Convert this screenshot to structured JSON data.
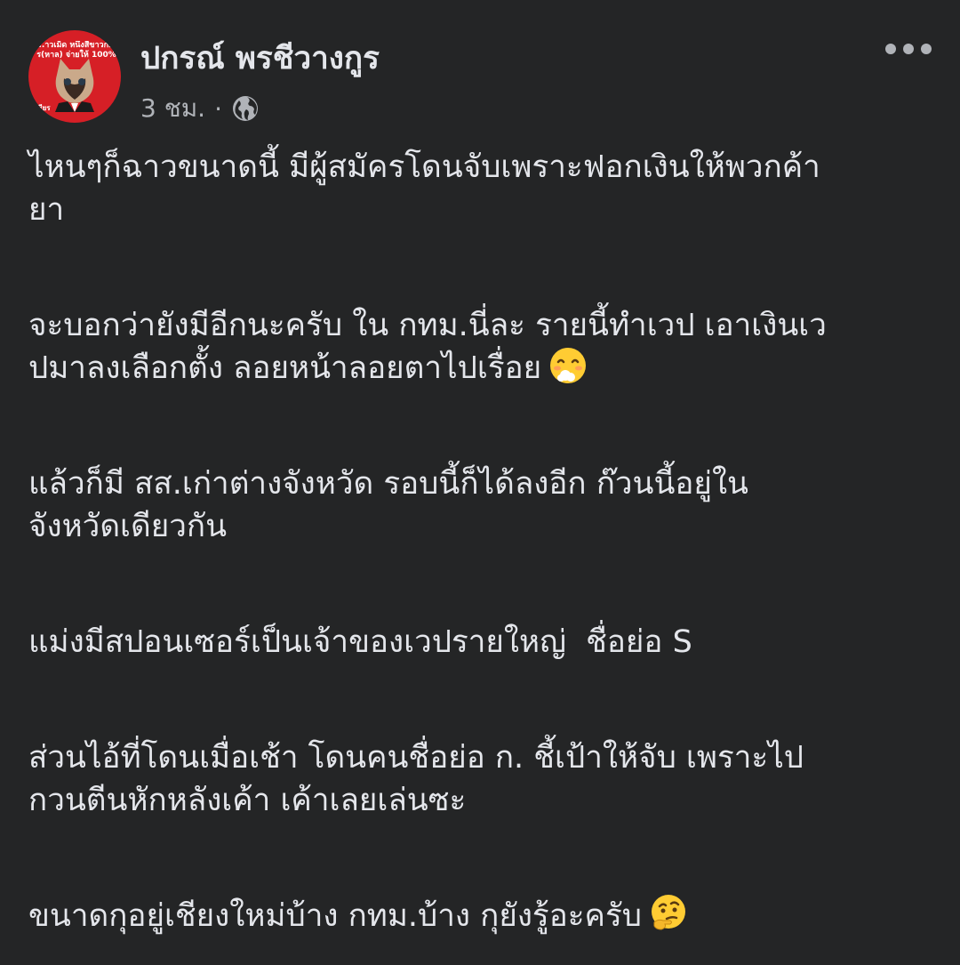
{
  "post": {
    "author": "ปกรณ์ พรชีวางกูร",
    "time": "3 ชม.",
    "separator": "·",
    "privacy_icon": "globe-icon",
    "more_icon": "more-horizontal-icon",
    "avatar": {
      "text_line1": "...าวเม็ด หนึ่งสีขาวกมะ",
      "text_line2": "ร(หาล) จ่ายให้ 100%",
      "text_line3": "ชเชียร",
      "background": "#d61f26"
    },
    "paragraphs": [
      {
        "lines": [
          "ไหนๆก็ฉาวขนาดนี้ มีผู้สมัครโดนจับเพราะฟอกเงินให้พวกค้า",
          "ยา"
        ]
      },
      {
        "lines": [
          "จะบอกว่ายังมีอีกนะครับ ใน กทม.นี่ละ รายนี้ทำเวป เอาเงินเว",
          "ปมาลงเลือกตั้ง ลอยหน้าลอยตาไปเรื่อย"
        ],
        "emoji": "face-exhaling-emoji"
      },
      {
        "lines": [
          "แล้วก็มี สส.เก่าต่างจังหวัด รอบนี้ก็ได้ลงอีก ก๊วนนี้อยู่ใน",
          "จังหวัดเดียวกัน"
        ]
      },
      {
        "lines": [
          "แม่งมีสปอนเซอร์เป็นเจ้าของเวปรายใหญ่  ชื่อย่อ S"
        ]
      },
      {
        "lines": [
          "ส่วนไอ้ที่โดนเมื่อเช้า โดนคนชื่อย่อ ก. ชี้เป้าให้จับ เพราะไป",
          "กวนตีนหักหลังเค้า เค้าเลยเล่นซะ"
        ]
      },
      {
        "lines": [
          "ขนาดกุอยู่เชียงใหม่บ้าง กทม.บ้าง กุยังรู้อะครับ"
        ],
        "emoji": "thinking-face-emoji"
      }
    ]
  },
  "colors": {
    "background": "#242526",
    "primary_text": "#e4e6eb",
    "secondary_text": "#b0b3b8"
  }
}
